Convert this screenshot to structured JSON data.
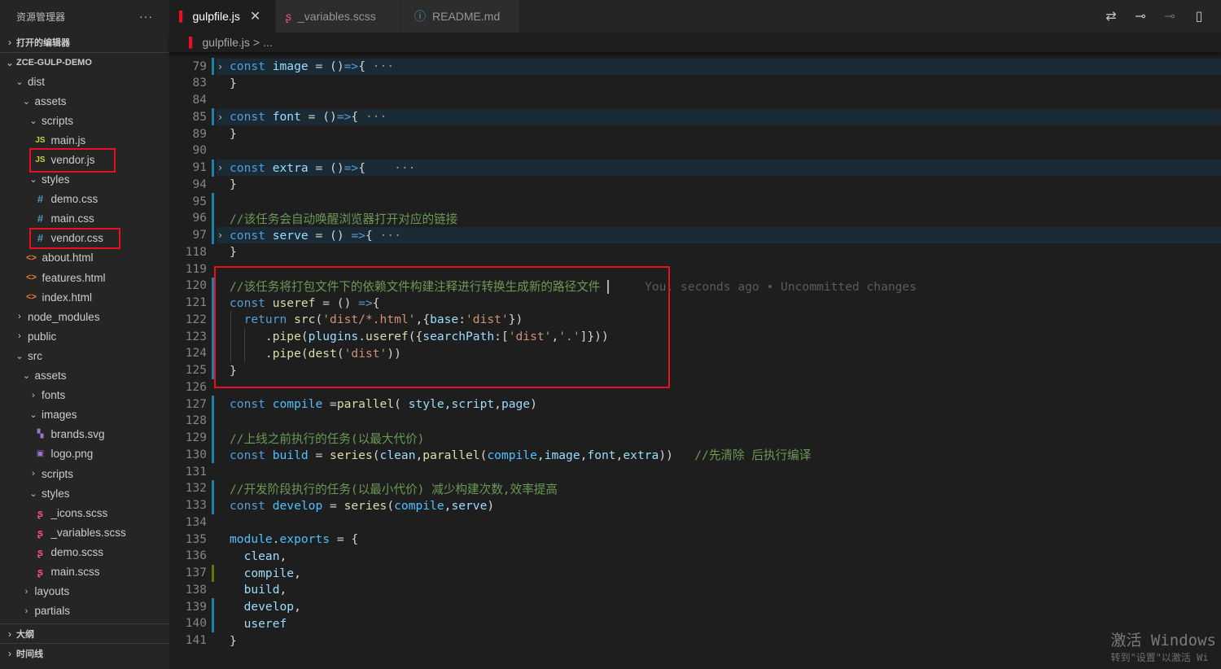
{
  "sidebar": {
    "title": "资源管理器",
    "more": "···",
    "open_editors": "打开的编辑器",
    "project": "ZCE-GULP-DEMO",
    "outline": "大纲",
    "timeline": "时间线",
    "tree": [
      {
        "label": "dist",
        "twisty": "open",
        "icon": "",
        "depth": 0
      },
      {
        "label": "assets",
        "twisty": "open",
        "icon": "",
        "depth": 1
      },
      {
        "label": "scripts",
        "twisty": "open",
        "icon": "",
        "depth": 2
      },
      {
        "label": "main.js",
        "twisty": "",
        "icon": "JS",
        "kind": "js",
        "depth": 3
      },
      {
        "label": "vendor.js",
        "twisty": "",
        "icon": "JS",
        "kind": "js",
        "depth": 3
      },
      {
        "label": "styles",
        "twisty": "open",
        "icon": "",
        "depth": 2
      },
      {
        "label": "demo.css",
        "twisty": "",
        "icon": "#",
        "kind": "css",
        "depth": 3
      },
      {
        "label": "main.css",
        "twisty": "",
        "icon": "#",
        "kind": "css",
        "depth": 3
      },
      {
        "label": "vendor.css",
        "twisty": "",
        "icon": "#",
        "kind": "css",
        "depth": 3
      },
      {
        "label": "about.html",
        "twisty": "",
        "icon": "<>",
        "kind": "html",
        "depth": 1
      },
      {
        "label": "features.html",
        "twisty": "",
        "icon": "<>",
        "kind": "html",
        "depth": 1
      },
      {
        "label": "index.html",
        "twisty": "",
        "icon": "<>",
        "kind": "html",
        "depth": 1
      },
      {
        "label": "node_modules",
        "twisty": "closed",
        "icon": "",
        "depth": 0
      },
      {
        "label": "public",
        "twisty": "closed",
        "icon": "",
        "depth": 0
      },
      {
        "label": "src",
        "twisty": "open",
        "icon": "",
        "depth": 0
      },
      {
        "label": "assets",
        "twisty": "open",
        "icon": "",
        "depth": 1
      },
      {
        "label": "fonts",
        "twisty": "closed",
        "icon": "",
        "depth": 2
      },
      {
        "label": "images",
        "twisty": "open",
        "icon": "",
        "depth": 2
      },
      {
        "label": "brands.svg",
        "twisty": "",
        "icon": "▚",
        "kind": "svg",
        "depth": 3
      },
      {
        "label": "logo.png",
        "twisty": "",
        "icon": "▣",
        "kind": "png",
        "depth": 3
      },
      {
        "label": "scripts",
        "twisty": "closed",
        "icon": "",
        "depth": 2
      },
      {
        "label": "styles",
        "twisty": "open",
        "icon": "",
        "depth": 2
      },
      {
        "label": "_icons.scss",
        "twisty": "",
        "icon": "ʂ",
        "kind": "scss",
        "depth": 3
      },
      {
        "label": "_variables.scss",
        "twisty": "",
        "icon": "ʂ",
        "kind": "scss",
        "depth": 3
      },
      {
        "label": "demo.scss",
        "twisty": "",
        "icon": "ʂ",
        "kind": "scss",
        "depth": 3
      },
      {
        "label": "main.scss",
        "twisty": "",
        "icon": "ʂ",
        "kind": "scss",
        "depth": 3
      },
      {
        "label": "layouts",
        "twisty": "closed",
        "icon": "",
        "depth": 1
      },
      {
        "label": "partials",
        "twisty": "closed",
        "icon": "",
        "depth": 1
      }
    ]
  },
  "tabs": [
    {
      "label": "gulpfile.js",
      "active": true,
      "icon": "gulp-icon",
      "close": "✕"
    },
    {
      "label": "_variables.scss",
      "active": false,
      "icon": "sass-icon"
    },
    {
      "label": "README.md",
      "active": false,
      "icon": "info-icon"
    }
  ],
  "breadcrumb": {
    "file": "gulpfile.js",
    "sep": ">",
    "rest": "..."
  },
  "editor": {
    "blame": "You, seconds ago • Uncommitted changes",
    "lines": [
      {
        "n": "79",
        "fold": "›",
        "folded": true,
        "gutter": "blue",
        "html": "<span class='kw'>const</span> <span class='vr'>image</span> = ()<span class='kw'>=></span>{ <span class='ellip'>···</span>"
      },
      {
        "n": "83",
        "html": "}"
      },
      {
        "n": "84",
        "html": ""
      },
      {
        "n": "85",
        "fold": "›",
        "folded": true,
        "gutter": "blue",
        "html": "<span class='kw'>const</span> <span class='vr'>font</span> = ()<span class='kw'>=></span>{ <span class='ellip'>···</span>"
      },
      {
        "n": "89",
        "html": "}"
      },
      {
        "n": "90",
        "html": ""
      },
      {
        "n": "91",
        "fold": "›",
        "folded": true,
        "gutter": "blue",
        "html": "<span class='kw'>const</span> <span class='vr'>extra</span> = ()<span class='kw'>=></span>{    <span class='ellip'>···</span>"
      },
      {
        "n": "94",
        "html": "}"
      },
      {
        "n": "95",
        "gutter": "blue",
        "html": ""
      },
      {
        "n": "96",
        "gutter": "blue",
        "html": "<span class='cm'>//该任务会自动唤醒浏览器打开对应的链接</span>"
      },
      {
        "n": "97",
        "fold": "›",
        "folded": true,
        "gutter": "blue",
        "html": "<span class='kw'>const</span> <span class='vr'>serve</span> = () <span class='kw'>=></span>{ <span class='ellip'>···</span>"
      },
      {
        "n": "118",
        "html": "}"
      },
      {
        "n": "119",
        "html": ""
      },
      {
        "n": "120",
        "gutter": "blue",
        "html": "<span class='cm'>//该任务将打包文件下的依赖文件构建注释进行转换生成新的路径文件</span> <span class='cursor'></span>     <span class='blame'>You, seconds ago • Uncommitted changes</span>"
      },
      {
        "n": "121",
        "gutter": "blue",
        "html": "<span class='kw'>const</span> <span class='fn'>useref</span> = () <span class='kw'>=></span>{"
      },
      {
        "n": "122",
        "gutter": "blue",
        "html": "  <span class='kw'>return</span> <span class='fn'>src</span>(<span class='st'>'dist/*.html'</span>,{<span class='vr'>base</span>:<span class='st'>'dist'</span>})"
      },
      {
        "n": "123",
        "gutter": "blue",
        "html": "     .<span class='fn'>pipe</span>(<span class='vr'>plugins</span>.<span class='fn'>useref</span>({<span class='vr'>searchPath</span>:[<span class='st'>'dist'</span>,<span class='st'>'.'</span>]}))"
      },
      {
        "n": "124",
        "gutter": "blue",
        "html": "     .<span class='fn'>pipe</span>(<span class='fn'>dest</span>(<span class='st'>'dist'</span>))"
      },
      {
        "n": "125",
        "gutter": "blue",
        "html": "}"
      },
      {
        "n": "126",
        "html": ""
      },
      {
        "n": "127",
        "gutter": "blue",
        "html": "<span class='kw'>const</span> <span class='df'>compile</span> =<span class='fn'>parallel</span>( <span class='vr'>style</span>,<span class='vr'>script</span>,<span class='vr'>page</span>)"
      },
      {
        "n": "128",
        "gutter": "blue",
        "html": ""
      },
      {
        "n": "129",
        "gutter": "blue",
        "html": "<span class='cm'>//上线之前执行的任务(以最大代价)</span>"
      },
      {
        "n": "130",
        "gutter": "blue",
        "html": "<span class='kw'>const</span> <span class='df'>build</span> = <span class='fn'>series</span>(<span class='vr'>clean</span>,<span class='fn'>parallel</span>(<span class='df'>compile</span>,<span class='vr'>image</span>,<span class='vr'>font</span>,<span class='vr'>extra</span>))   <span class='cm'>//先清除 后执行编译</span>"
      },
      {
        "n": "131",
        "html": ""
      },
      {
        "n": "132",
        "gutter": "blue",
        "html": "<span class='cm'>//开发阶段执行的任务(以最小代价) 减少构建次数,效率提高</span>"
      },
      {
        "n": "133",
        "gutter": "blue",
        "html": "<span class='kw'>const</span> <span class='df'>develop</span> = <span class='fn'>series</span>(<span class='df'>compile</span>,<span class='vr'>serve</span>)"
      },
      {
        "n": "134",
        "html": ""
      },
      {
        "n": "135",
        "html": "<span class='df'>module</span>.<span class='df'>exports</span> = {"
      },
      {
        "n": "136",
        "html": "  <span class='vr'>clean</span>,"
      },
      {
        "n": "137",
        "gutter": "green",
        "html": "  <span class='vr'>compile</span>,"
      },
      {
        "n": "138",
        "html": "  <span class='vr'>build</span>,"
      },
      {
        "n": "139",
        "gutter": "blue",
        "html": "  <span class='vr'>develop</span>,"
      },
      {
        "n": "140",
        "gutter": "blue",
        "html": "  <span class='vr'>useref</span>"
      },
      {
        "n": "141",
        "html": "}"
      }
    ]
  },
  "watermark": {
    "line1": "激活 Windows",
    "line2": "转到\"设置\"以激活 Wi"
  },
  "colors": {
    "highlight_box": "#e81123",
    "gutter_blue": "#1b81a8",
    "gutter_green": "#587c0c"
  }
}
